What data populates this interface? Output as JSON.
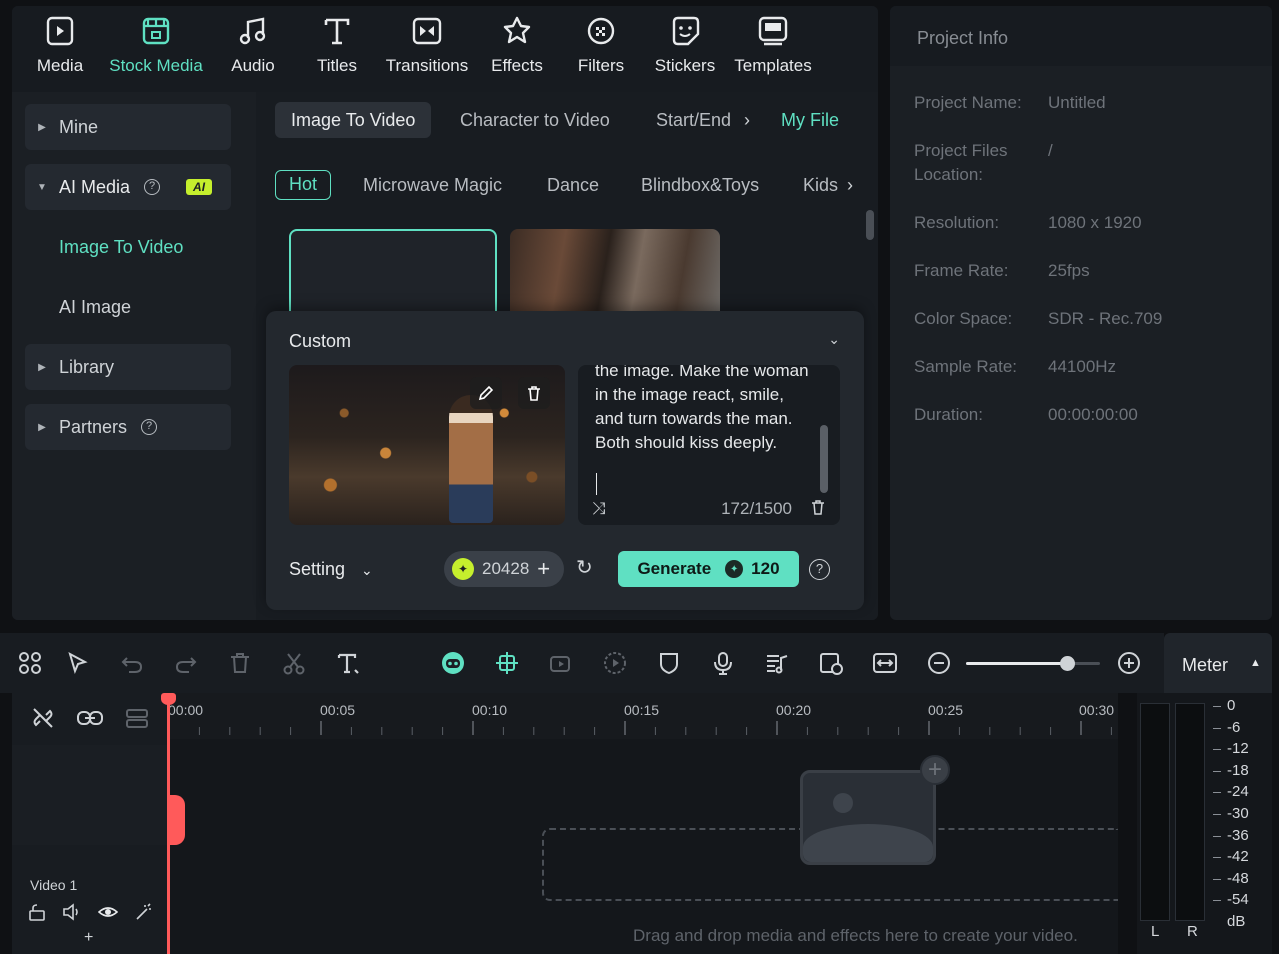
{
  "toolbar": {
    "items": [
      {
        "label": "Media",
        "icon": "media-icon"
      },
      {
        "label": "Stock Media",
        "icon": "stock-media-icon"
      },
      {
        "label": "Audio",
        "icon": "audio-icon"
      },
      {
        "label": "Titles",
        "icon": "titles-icon"
      },
      {
        "label": "Transitions",
        "icon": "transitions-icon"
      },
      {
        "label": "Effects",
        "icon": "effects-icon"
      },
      {
        "label": "Filters",
        "icon": "filters-icon"
      },
      {
        "label": "Stickers",
        "icon": "stickers-icon"
      },
      {
        "label": "Templates",
        "icon": "templates-icon"
      }
    ],
    "active": "Stock Media"
  },
  "sidebar": {
    "items": [
      {
        "label": "Mine"
      },
      {
        "label": "AI Media",
        "badge": "AI"
      },
      {
        "label": "Image To Video"
      },
      {
        "label": "AI Image"
      },
      {
        "label": "Library"
      },
      {
        "label": "Partners"
      }
    ]
  },
  "tabs": [
    "Image To Video",
    "Character to Video",
    "Start/End",
    "My File"
  ],
  "chips": [
    "Hot",
    "Microwave Magic",
    "Dance",
    "Blindbox&Toys",
    "Kids"
  ],
  "custom": {
    "title": "Custom",
    "prompt_text": "the image. Make the woman in the image react, smile, and turn towards the man. Both should kiss deeply.",
    "char_count": "172/1500",
    "setting_label": "Setting",
    "credits": "20428",
    "generate_label": "Generate",
    "generate_cost": "120"
  },
  "project_info": {
    "title": "Project Info",
    "rows": [
      {
        "label": "Project Name:",
        "value": "Untitled"
      },
      {
        "label": "Project Files Location:",
        "value": "/"
      },
      {
        "label": "Resolution:",
        "value": "1080 x 1920"
      },
      {
        "label": "Frame Rate:",
        "value": "25fps"
      },
      {
        "label": "Color Space:",
        "value": "SDR - Rec.709"
      },
      {
        "label": "Sample Rate:",
        "value": "44100Hz"
      },
      {
        "label": "Duration:",
        "value": "00:00:00:00"
      }
    ]
  },
  "timeline": {
    "ruler": [
      "00:00",
      "00:05",
      "00:10",
      "00:15",
      "00:20",
      "00:25",
      "00:30"
    ],
    "track_label": "Video 1",
    "drop_hint": "Drag and drop media and effects here to create your video.",
    "zoom_level": 0.75,
    "meter_label": "Meter",
    "meter_scale": [
      "0",
      "-6",
      "-12",
      "-18",
      "-24",
      "-30",
      "-36",
      "-42",
      "-48",
      "-54",
      "dB"
    ],
    "meter_channels": [
      "L",
      "R"
    ]
  },
  "colors": {
    "accent": "#5fe0c2",
    "ai_badge": "#c5ef2d",
    "playhead": "#ff5a5a"
  }
}
